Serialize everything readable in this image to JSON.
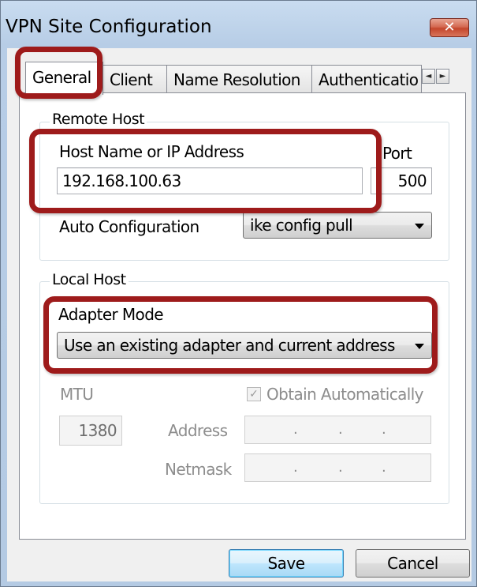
{
  "window": {
    "title": "VPN Site Configuration",
    "close_label": "✕"
  },
  "tabs": [
    {
      "label": "General",
      "active": true
    },
    {
      "label": "Client",
      "active": false
    },
    {
      "label": "Name Resolution",
      "active": false
    },
    {
      "label": "Authenticatio",
      "active": false
    }
  ],
  "tab_scroll": {
    "left": "◄",
    "right": "►"
  },
  "remote_host": {
    "group_label": "Remote Host",
    "host_label": "Host Name or IP Address",
    "host_value": "192.168.100.63",
    "port_label": "Port",
    "port_value": "500",
    "auto_config_label": "Auto Configuration",
    "auto_config_value": "ike config pull"
  },
  "local_host": {
    "group_label": "Local Host",
    "adapter_mode_label": "Adapter Mode",
    "adapter_mode_value": "Use an existing adapter and current address",
    "mtu_label": "MTU",
    "mtu_value": "1380",
    "obtain_auto_label": "Obtain Automatically",
    "obtain_auto_checked": true,
    "address_label": "Address",
    "netmask_label": "Netmask",
    "ip_dot": "."
  },
  "buttons": {
    "save": "Save",
    "cancel": "Cancel"
  },
  "colors": {
    "highlight": "#9e1b1b",
    "titlebar": "#b9cfe7",
    "close_button": "#c4462c"
  }
}
